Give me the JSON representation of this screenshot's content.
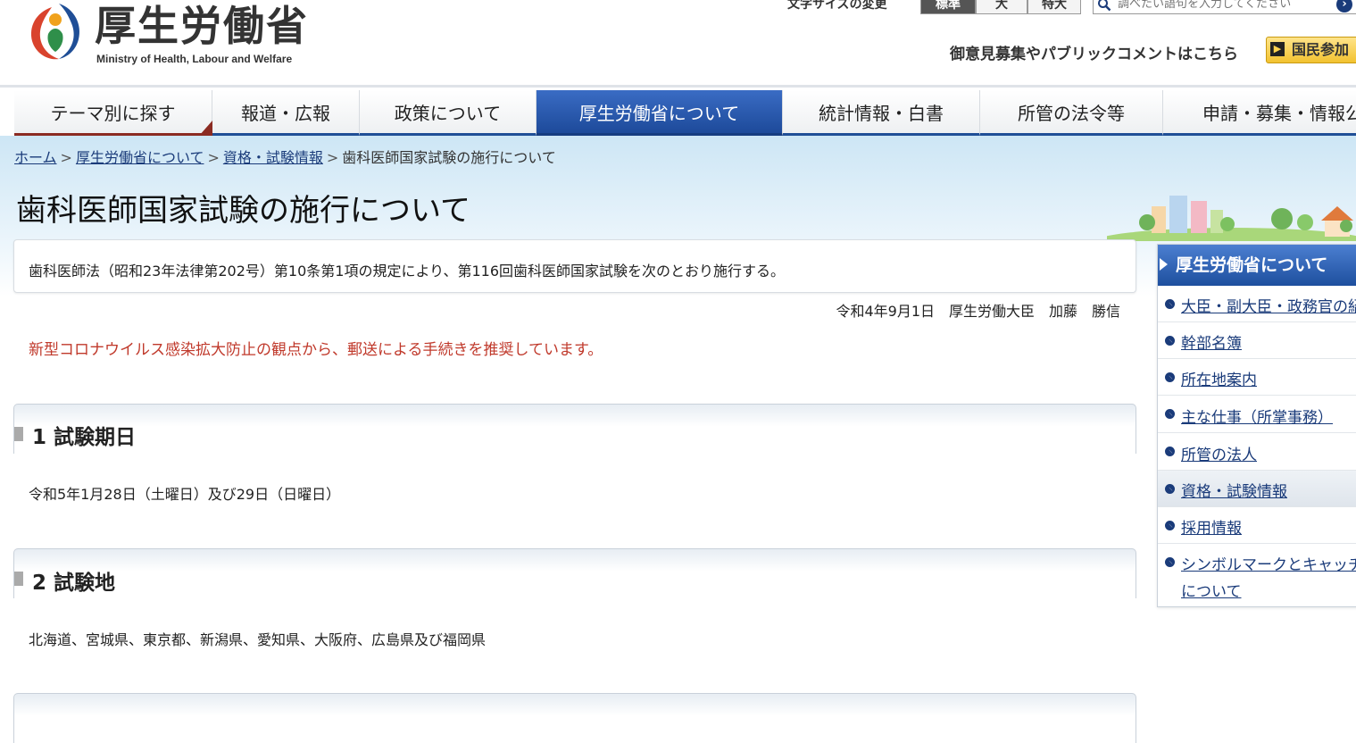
{
  "header": {
    "logo_ja": "厚生労働省",
    "logo_en": "Ministry of Health, Labour and Welfare",
    "font_size_label": "文字サイズの変更",
    "font_sizes": [
      "標準",
      "大",
      "特大"
    ],
    "search_placeholder": "調べたい語句を入力してください",
    "comment_link": "御意見募集やパブリックコメントはこちら",
    "participation_button": "国民参加"
  },
  "nav": {
    "items": [
      "テーマ別に探す",
      "報道・広報",
      "政策について",
      "厚生労働省について",
      "統計情報・白書",
      "所管の法令等",
      "申請・募集・情報公"
    ],
    "active_index": 3
  },
  "breadcrumb": {
    "items": [
      "ホーム",
      "厚生労働省について",
      "資格・試験情報"
    ],
    "current": "歯科医師国家試験の施行について",
    "separator": ">"
  },
  "page": {
    "title": "歯科医師国家試験の施行について",
    "intro": "歯科医師法（昭和23年法律第202号）第10条第1項の規定により、第116回歯科医師国家試験を次のとおり施行する。",
    "signature": "令和4年9月1日　厚生労働大臣　加藤　勝信",
    "notice": "新型コロナウイルス感染拡大防止の観点から、郵送による手続きを推奨しています。"
  },
  "sections": [
    {
      "title": "1 試験期日",
      "body": "令和5年1月28日（土曜日）及び29日（日曜日）"
    },
    {
      "title": "2 試験地",
      "body": "北海道、宮城県、東京都、新潟県、愛知県、大阪府、広島県及び福岡県"
    }
  ],
  "side_menu": {
    "title": "厚生労働省について",
    "items": [
      "大臣・副大臣・政務官の紹",
      "幹部名簿",
      "所在地案内",
      "主な仕事（所掌事務）",
      "所管の法人",
      "資格・試験情報",
      "採用情報",
      "シンボルマークとキャッチ"
    ],
    "item_8_line2": "について",
    "active_index": 5
  },
  "colors": {
    "nav_active": "#1d4a9a",
    "link": "#1a3b7a",
    "notice": "#c0392b",
    "accent_button": "#f2c230"
  }
}
